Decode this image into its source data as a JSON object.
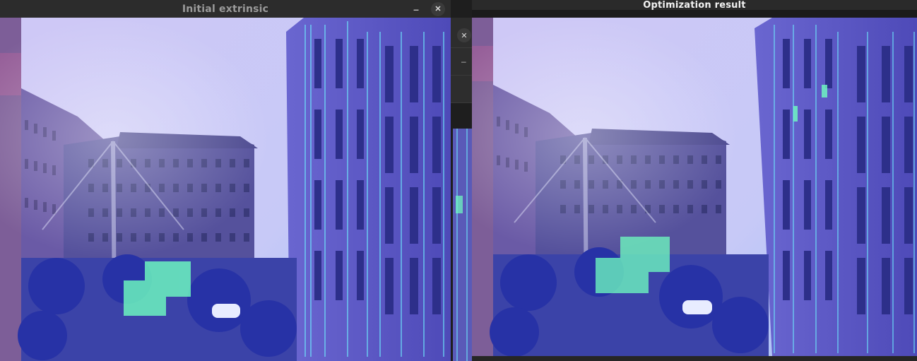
{
  "windows": {
    "left": {
      "title": "Initial extrinsic",
      "minimize_glyph": "–",
      "close_glyph": "✕"
    },
    "middle": {
      "close_glyph": "✕",
      "minimize_glyph": "–"
    },
    "right": {
      "title": "Optimization result"
    }
  },
  "colors": {
    "titlebar": "#2c2c2c",
    "sky": "#c5c6f6",
    "building": "#5a5ac0",
    "lidar_points": "#5ff0ff",
    "lidar_green": "#6fffc0"
  },
  "icons": [
    "minimize-icon",
    "close-icon"
  ]
}
